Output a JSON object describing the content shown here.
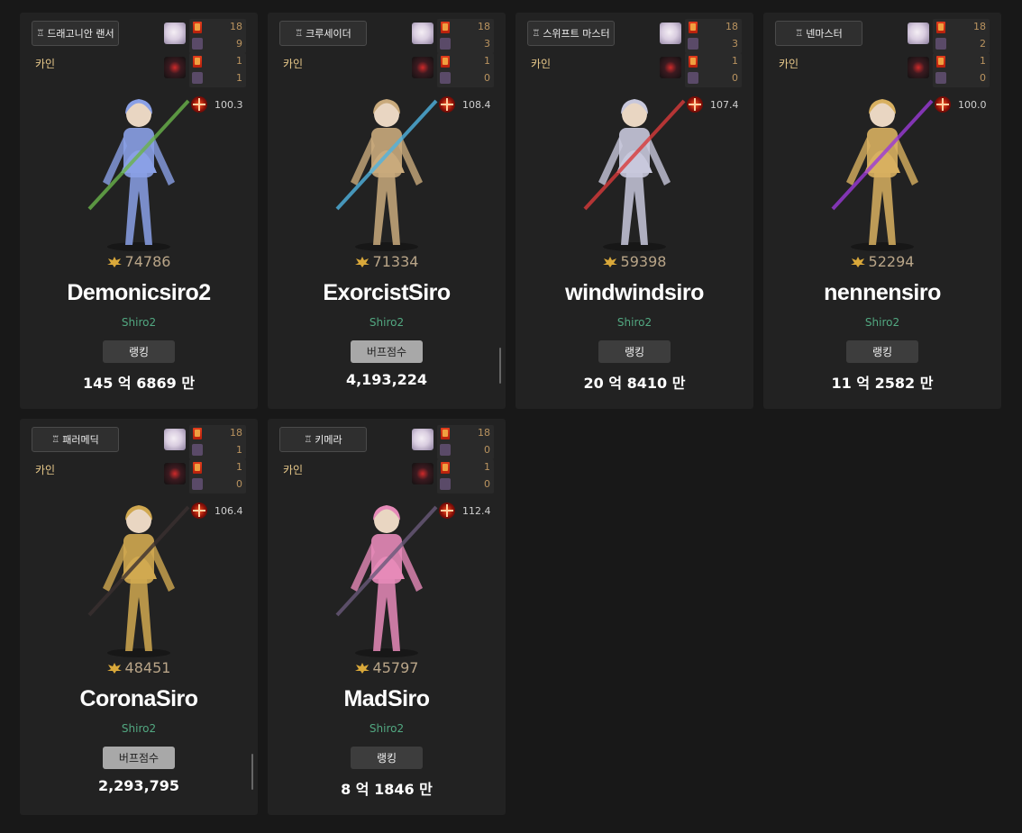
{
  "cards": [
    {
      "job": "드래고니안 랜서",
      "server": "카인",
      "stats": [
        "18",
        "9",
        "1",
        "1"
      ],
      "cross": "100.3",
      "fame": "74786",
      "name": "Demonicsiro2",
      "adventure": "Shiro2",
      "button": "랭킹",
      "score": "145 억 6869 만",
      "buff": false,
      "char_color": "#8aa0e6",
      "accent": "#6ab34a"
    },
    {
      "job": "크루세이더",
      "server": "카인",
      "stats": [
        "18",
        "3",
        "1",
        "0"
      ],
      "cross": "108.4",
      "fame": "71334",
      "name": "ExorcistSiro",
      "adventure": "Shiro2",
      "button": "버프점수",
      "score": "4,193,224",
      "buff": true,
      "char_color": "#c9aa7c",
      "accent": "#4fb3e0"
    },
    {
      "job": "스위프트 마스터",
      "server": "카인",
      "stats": [
        "18",
        "3",
        "1",
        "0"
      ],
      "cross": "107.4",
      "fame": "59398",
      "name": "windwindsiro",
      "adventure": "Shiro2",
      "button": "랭킹",
      "score": "20 억 8410 만",
      "buff": false,
      "char_color": "#c8c8dc",
      "accent": "#d93a3a"
    },
    {
      "job": "넨마스터",
      "server": "카인",
      "stats": [
        "18",
        "2",
        "1",
        "0"
      ],
      "cross": "100.0",
      "fame": "52294",
      "name": "nennensiro",
      "adventure": "Shiro2",
      "button": "랭킹",
      "score": "11 억 2582 만",
      "buff": false,
      "char_color": "#d8b060",
      "accent": "#9b3ad8"
    },
    {
      "job": "패러메딕",
      "server": "카인",
      "stats": [
        "18",
        "1",
        "1",
        "0"
      ],
      "cross": "106.4",
      "fame": "48451",
      "name": "CoronaSiro",
      "adventure": "Shiro2",
      "button": "버프점수",
      "score": "2,293,795",
      "buff": true,
      "char_color": "#d0a850",
      "accent": "#3a3030"
    },
    {
      "job": "키메라",
      "server": "카인",
      "stats": [
        "18",
        "0",
        "1",
        "0"
      ],
      "cross": "112.4",
      "fame": "45797",
      "name": "MadSiro",
      "adventure": "Shiro2",
      "button": "랭킹",
      "score": "8 억 1846 만",
      "buff": false,
      "char_color": "#e68ab8",
      "accent": "#6a5a7a"
    }
  ],
  "colors": {
    "background": "#181818",
    "card": "#222222",
    "fame": "#b9a588",
    "adventure": "#52a881",
    "stat_number": "#b9935f"
  }
}
